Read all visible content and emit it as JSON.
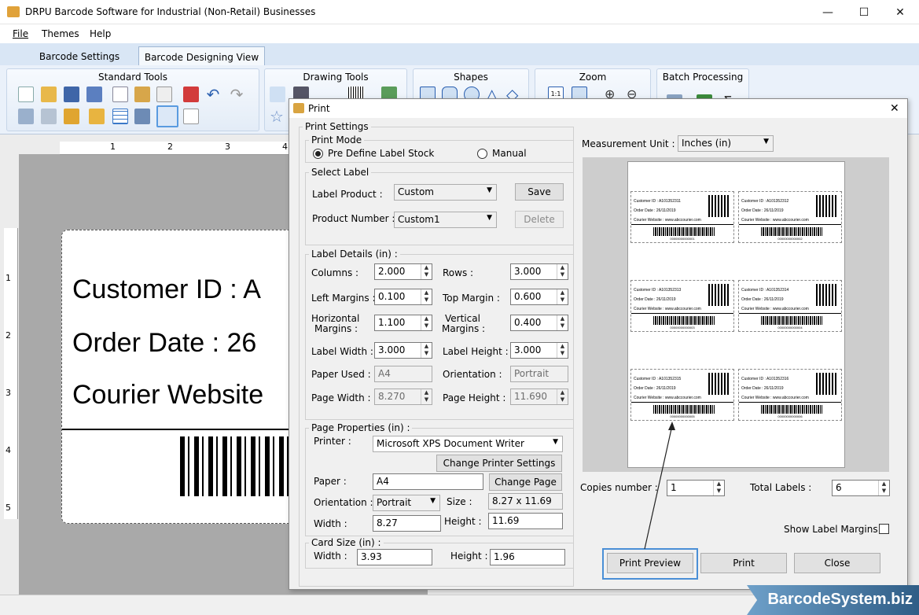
{
  "window": {
    "title": "DRPU Barcode Software for Industrial (Non-Retail) Businesses",
    "minimize": "—",
    "maximize": "☐",
    "close": "✕"
  },
  "menu": [
    "File",
    "Themes",
    "Help"
  ],
  "tabs": [
    "Barcode Settings",
    "Barcode Designing View"
  ],
  "ribbon": {
    "groups": [
      "Standard Tools",
      "Drawing Tools",
      "Shapes",
      "Zoom",
      "Batch Processing"
    ]
  },
  "rulers": {
    "h": [
      "1",
      "2",
      "3",
      "4"
    ],
    "v": [
      "1",
      "2",
      "3",
      "4",
      "5"
    ]
  },
  "label_design": {
    "line1": "Customer ID : A",
    "line2": "Order Date :   26",
    "line3": "Courier Website"
  },
  "dialog": {
    "title": "Print",
    "close": "✕",
    "print_settings": "Print Settings",
    "print_mode": {
      "legend": "Print Mode",
      "option1": "Pre Define Label Stock",
      "option2": "Manual",
      "selected": "Pre Define Label Stock"
    },
    "select_label": {
      "legend": "Select Label",
      "label_product_lbl": "Label Product :",
      "label_product_val": "Custom",
      "save": "Save",
      "product_number_lbl": "Product Number :",
      "product_number_val": "Custom1",
      "delete": "Delete"
    },
    "label_details": {
      "legend": "Label Details (in) :",
      "columns_lbl": "Columns :",
      "columns": "2.000",
      "rows_lbl": "Rows :",
      "rows": "3.000",
      "left_margins_lbl": "Left Margins :",
      "left_margins": "0.100",
      "top_margin_lbl": "Top Margin :",
      "top_margin": "0.600",
      "h_margins_lbl1": "Horizontal",
      "h_margins_lbl2": "Margins :",
      "h_margins": "1.100",
      "v_margins_lbl1": "Vertical",
      "v_margins_lbl2": "Margins :",
      "v_margins": "0.400",
      "label_width_lbl": "Label Width :",
      "label_width": "3.000",
      "label_height_lbl": "Label Height :",
      "label_height": "3.000",
      "paper_used_lbl": "Paper Used :",
      "paper_used": "A4",
      "orientation_lbl": "Orientation :",
      "orientation": "Portrait",
      "page_width_lbl": "Page Width :",
      "page_width": "8.270",
      "page_height_lbl": "Page Height :",
      "page_height": "11.690"
    },
    "page_properties": {
      "legend": "Page Properties (in) :",
      "printer_lbl": "Printer :",
      "printer": "Microsoft XPS Document Writer",
      "change_printer": "Change Printer Settings",
      "paper_lbl": "Paper :",
      "paper": "A4",
      "change_page": "Change Page",
      "orientation_lbl": "Orientation :",
      "orientation": "Portrait",
      "size_lbl": "Size :",
      "size": "8.27 x 11.69",
      "width_lbl": "Width :",
      "width": "8.27",
      "height_lbl": "Height :",
      "height": "11.69"
    },
    "card_size": {
      "legend": "Card Size (in) :",
      "width_lbl": "Width :",
      "width": "3.93",
      "height_lbl": "Height :",
      "height": "1.96"
    },
    "measurement_unit_lbl": "Measurement Unit :",
    "measurement_unit": "Inches (in)",
    "preview_labels": [
      {
        "id": "Customer ID  :  A101352311",
        "date": "Order Date  :  26/11/2019",
        "web": "Courier Website  :  www.abccourier.com",
        "num": "00000000000001"
      },
      {
        "id": "Customer ID  :  A101352312",
        "date": "Order Date  :  26/11/2019",
        "web": "Courier Website  :  www.abccourier.com",
        "num": "00000000000002"
      },
      {
        "id": "Customer ID  :  A101352313",
        "date": "Order Date  :  26/11/2019",
        "web": "Courier Website  :  www.abccourier.com",
        "num": "00000000000003"
      },
      {
        "id": "Customer ID  :  A101352314",
        "date": "Order Date  :  26/11/2019",
        "web": "Courier Website  :  www.abccourier.com",
        "num": "00000000000004"
      },
      {
        "id": "Customer ID  :  A101352315",
        "date": "Order Date  :  26/11/2019",
        "web": "Courier Website  :  www.abccourier.com",
        "num": "00000000000005"
      },
      {
        "id": "Customer ID  :  A101352316",
        "date": "Order Date  :  26/11/2019",
        "web": "Courier Website  :  www.abccourier.com",
        "num": "00000000000006"
      }
    ],
    "copies_lbl": "Copies number :",
    "copies": "1",
    "total_labels_lbl": "Total Labels :",
    "total_labels": "6",
    "show_margins_lbl": "Show Label Margins",
    "print_preview": "Print Preview",
    "print": "Print",
    "close_btn": "Close"
  },
  "brand": "BarcodeSystem.biz",
  "colors": {
    "accent": "#3c7fb1",
    "tab_bar": "#d9e6f5"
  }
}
